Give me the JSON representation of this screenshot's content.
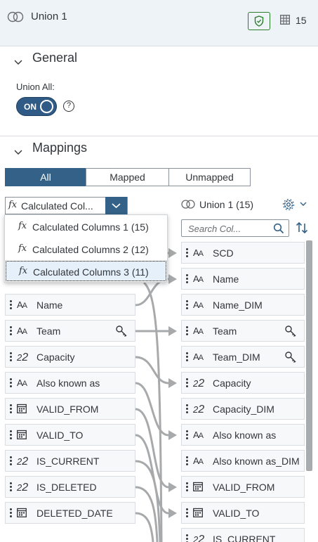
{
  "header": {
    "title": "Union 1",
    "count": "15",
    "union_icon": "union-icon",
    "shield_icon": "shield-check-icon",
    "table_icon": "table-icon"
  },
  "general": {
    "title": "General",
    "union_all_label": "Union All:",
    "toggle_label": "ON",
    "help": "?"
  },
  "mappings": {
    "title": "Mappings",
    "tabs": [
      {
        "label": "All",
        "active": true
      },
      {
        "label": "Mapped",
        "active": false
      },
      {
        "label": "Unmapped",
        "active": false
      }
    ],
    "source_combo": {
      "fx": "fx",
      "value": "Calculated Col..."
    },
    "dropdown_items": [
      {
        "fx": "fx",
        "label": "Calculated Columns 1 (15)",
        "selected": false
      },
      {
        "fx": "fx",
        "label": "Calculated Columns 2 (12)",
        "selected": false
      },
      {
        "fx": "fx",
        "label": "Calculated Columns 3 (11)",
        "selected": true
      }
    ],
    "target_title": "Union 1 (15)",
    "search_placeholder": "Search Col...",
    "source_columns": [
      {
        "type": "AA",
        "name": "Name",
        "key": false
      },
      {
        "type": "AA",
        "name": "Team",
        "key": true
      },
      {
        "type": "22",
        "name": "Capacity",
        "key": false
      },
      {
        "type": "AA",
        "name": "Also known as",
        "key": false
      },
      {
        "type": "cal",
        "name": "VALID_FROM",
        "key": false
      },
      {
        "type": "cal",
        "name": "VALID_TO",
        "key": false
      },
      {
        "type": "22",
        "name": "IS_CURRENT",
        "key": false
      },
      {
        "type": "22",
        "name": "IS_DELETED",
        "key": false
      },
      {
        "type": "cal",
        "name": "DELETED_DATE",
        "key": false
      }
    ],
    "target_columns": [
      {
        "type": "AA",
        "name": "SCD",
        "key": false
      },
      {
        "type": "AA",
        "name": "Name",
        "key": false
      },
      {
        "type": "AA",
        "name": "Name_DIM",
        "key": false
      },
      {
        "type": "AA",
        "name": "Team",
        "key": true
      },
      {
        "type": "AA",
        "name": "Team_DIM",
        "key": true
      },
      {
        "type": "22",
        "name": "Capacity",
        "key": false
      },
      {
        "type": "22",
        "name": "Capacity_DIM",
        "key": false
      },
      {
        "type": "AA",
        "name": "Also known as",
        "key": false
      },
      {
        "type": "AA",
        "name": "Also known as_DIM",
        "key": false
      },
      {
        "type": "cal",
        "name": "VALID_FROM",
        "key": false
      },
      {
        "type": "cal",
        "name": "VALID_TO",
        "key": false
      },
      {
        "type": "22",
        "name": "IS_CURRENT",
        "key": false
      }
    ]
  }
}
